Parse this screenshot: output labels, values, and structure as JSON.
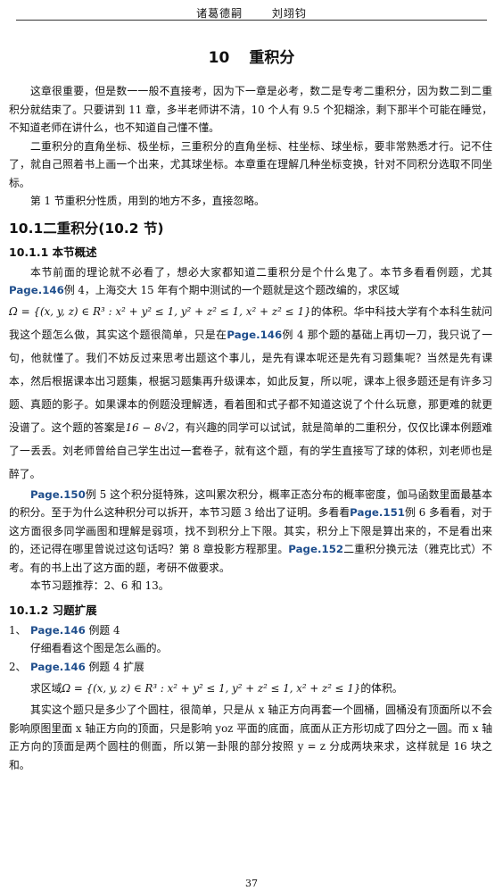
{
  "header": {
    "left": "诸葛德嗣",
    "right": "刘翊钧"
  },
  "chapter": {
    "number": "10",
    "title": "重积分"
  },
  "intro": [
    "这章很重要，但是数一一般不直接考，因为下一章是必考，数二是专考二重积分，因为数二到二重积分就结束了。只要讲到 11 章，多半老师讲不清，10 个人有 9.5 个犯糊涂，剩下那半个可能在睡觉，不知道老师在讲什么，也不知道自己懂不懂。",
    "二重积分的直角坐标、极坐标，三重积分的直角坐标、柱坐标、球坐标，要非常熟悉才行。记不住了，就自己照着书上画一个出来，尤其球坐标。本章重在理解几种坐标变换，针对不同积分选取不同坐标。",
    "第 1 节重积分性质，用到的地方不多，直接忽略。"
  ],
  "section": {
    "title": "10.1二重积分(10.2 节)"
  },
  "sub1": {
    "title": "10.1.1 本节概述"
  },
  "p1": {
    "a": "本节前面的理论就不必看了，想必大家都知道二重积分是个什么鬼了。本节多看看例题，尤其",
    "pg1": "Page.146",
    "b": "例 4，上海交大 15 年有个期中测试的一个题就是这个题改编的，求区域",
    "formula": "Ω = {(x, y, z) ∈ R³ : x² + y² ≤ 1, y² + z² ≤ 1, x² + z² ≤ 1}",
    "c": "的体积。华中科技大学有个本科生就问我这个题怎么做，其实这个题很简单，只是在",
    "pg2": "Page.146",
    "d": "例 4 那个题的基础上再切一刀，我只说了一句，他就懂了。我们不妨反过来思考出题这个事儿，是先有课本呢还是先有习题集呢？当然是先有课本，然后根据课本出习题集，根据习题集再升级课本，如此反复，所以呢，课本上很多题还是有许多习题、真题的影子。如果课本的例题没理解透，看着图和式子都不知道这说了个什么玩意，那更难的就更没谱了。这个题的答案是",
    "answer": "16 − 8√2",
    "e": "，有兴趣的同学可以试试，就是简单的二重积分，仅仅比课本例题难了一丢丢。刘老师曾给自己学生出过一套卷子，就有这个题，有的学生直接写了球的体积，刘老师也是醉了。"
  },
  "p2": {
    "pg1": "Page.150",
    "a": "例 5 这个积分挺特殊，这叫累次积分，概率正态分布的概率密度，伽马函数里面最基本的积分。至于为什么这种积分可以拆开，本节习题 3 给出了证明。多看看",
    "pg2": "Page.151",
    "b": "例 6 多看看，对于这方面很多同学画图和理解是弱项，找不到积分上下限。其实，积分上下限是算出来的，不是看出来的，还记得在哪里曾说过这句话吗？第 8 章投影方程那里。",
    "pg3": "Page.152",
    "c": "二重积分换元法（雅克比式）不考。有的书上出了这方面的题，考研不做要求。"
  },
  "p3": "本节习题推荐：2、6 和 13。",
  "sub2": {
    "title": "10.1.2 习题扩展"
  },
  "list": [
    {
      "num": "1、",
      "pg": "Page.146",
      "label": "例题 4",
      "sub": "仔细看看这个图是怎么画的。"
    },
    {
      "num": "2、",
      "pg": "Page.146",
      "label": "例题 4 扩展",
      "sub_a": "求区域",
      "formula": "Ω = {(x, y, z) ∈ R³ : x² + y² ≤ 1, y² + z² ≤ 1, x² + z² ≤ 1}",
      "sub_b": "的体积。"
    }
  ],
  "p4": "其实这个题只是多少了个圆柱，很简单，只是从 x 轴正方向再套一个圆桶，圆桶没有顶面所以不会影响原图里面 x 轴正方向的顶面，只是影响 yoz 平面的底面，底面从正方形切成了四分之一圆。而 x 轴正方向的顶面是两个圆柱的侧面，所以第一卦限的部分按照 y = z 分成两块来求，这样就是 16 块之和。",
  "footer": {
    "page": "37"
  },
  "colors": {
    "page_ref": "#1f4e8c"
  }
}
